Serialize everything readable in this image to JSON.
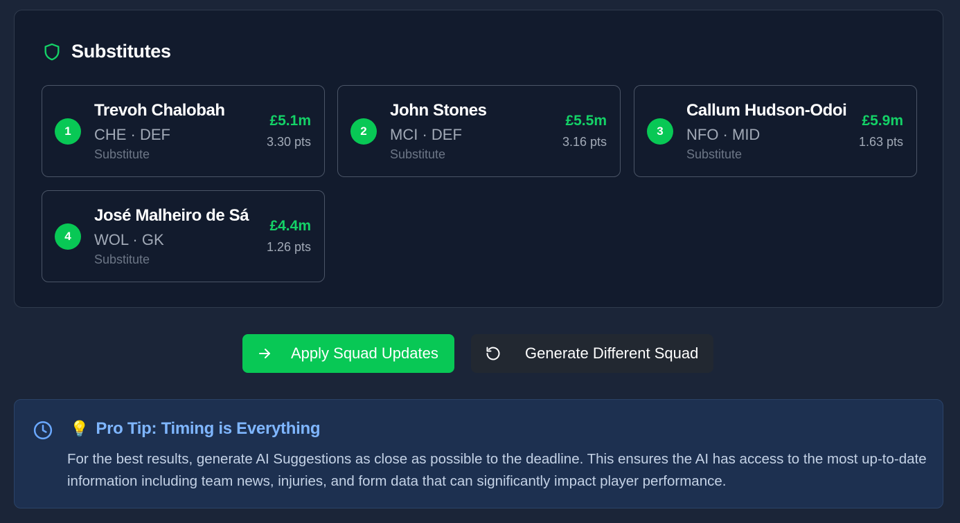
{
  "substitutes": {
    "title": "Substitutes",
    "header_icon": "shield-icon",
    "accent_color": "#08c855",
    "players": [
      {
        "rank": "1",
        "name": "Trevoh Chalobah",
        "meta": "CHE · DEF",
        "role": "Substitute",
        "price": "£5.1m",
        "points": "3.30 pts"
      },
      {
        "rank": "2",
        "name": "John Stones",
        "meta": "MCI · DEF",
        "role": "Substitute",
        "price": "£5.5m",
        "points": "3.16 pts"
      },
      {
        "rank": "3",
        "name": "Callum Hudson-Odoi",
        "meta": "NFO · MID",
        "role": "Substitute",
        "price": "£5.9m",
        "points": "1.63 pts"
      },
      {
        "rank": "4",
        "name": "José Malheiro de Sá",
        "meta": "WOL · GK",
        "role": "Substitute",
        "price": "£4.4m",
        "points": "1.26 pts"
      }
    ]
  },
  "actions": {
    "apply_label": "Apply Squad Updates",
    "apply_icon": "arrow-right-icon",
    "generate_label": "Generate Different Squad",
    "generate_icon": "refresh-icon"
  },
  "pro_tip": {
    "icon": "clock-icon",
    "emoji": "💡",
    "title": "Pro Tip: Timing is Everything",
    "body": "For the best results, generate AI Suggestions as close as possible to the deadline. This ensures the AI has access to the most up-to-date information including team news, injuries, and form data that can significantly impact player performance."
  }
}
